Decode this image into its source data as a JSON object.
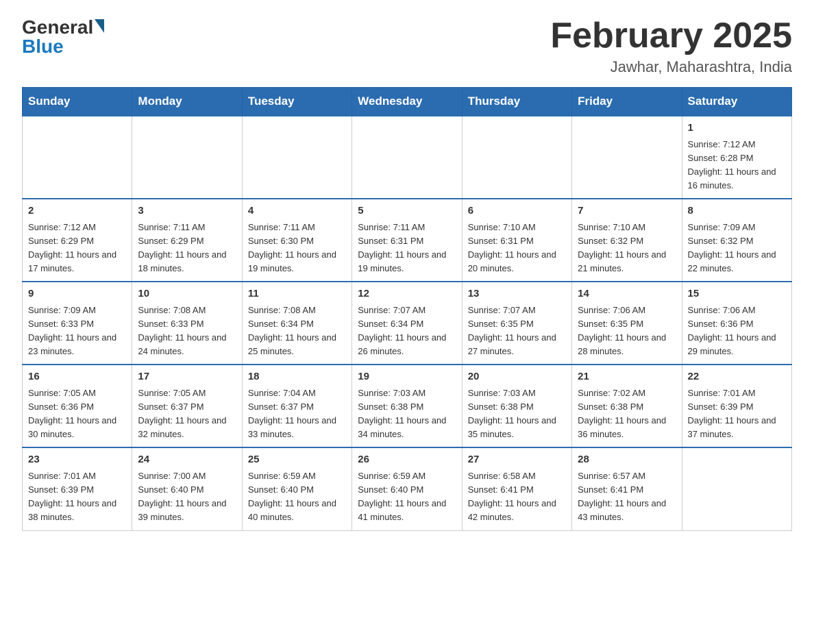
{
  "header": {
    "logo_general": "General",
    "logo_blue": "Blue",
    "month_title": "February 2025",
    "location": "Jawhar, Maharashtra, India"
  },
  "days_of_week": [
    "Sunday",
    "Monday",
    "Tuesday",
    "Wednesday",
    "Thursday",
    "Friday",
    "Saturday"
  ],
  "weeks": [
    [
      {
        "day": "",
        "info": ""
      },
      {
        "day": "",
        "info": ""
      },
      {
        "day": "",
        "info": ""
      },
      {
        "day": "",
        "info": ""
      },
      {
        "day": "",
        "info": ""
      },
      {
        "day": "",
        "info": ""
      },
      {
        "day": "1",
        "info": "Sunrise: 7:12 AM\nSunset: 6:28 PM\nDaylight: 11 hours and 16 minutes."
      }
    ],
    [
      {
        "day": "2",
        "info": "Sunrise: 7:12 AM\nSunset: 6:29 PM\nDaylight: 11 hours and 17 minutes."
      },
      {
        "day": "3",
        "info": "Sunrise: 7:11 AM\nSunset: 6:29 PM\nDaylight: 11 hours and 18 minutes."
      },
      {
        "day": "4",
        "info": "Sunrise: 7:11 AM\nSunset: 6:30 PM\nDaylight: 11 hours and 19 minutes."
      },
      {
        "day": "5",
        "info": "Sunrise: 7:11 AM\nSunset: 6:31 PM\nDaylight: 11 hours and 19 minutes."
      },
      {
        "day": "6",
        "info": "Sunrise: 7:10 AM\nSunset: 6:31 PM\nDaylight: 11 hours and 20 minutes."
      },
      {
        "day": "7",
        "info": "Sunrise: 7:10 AM\nSunset: 6:32 PM\nDaylight: 11 hours and 21 minutes."
      },
      {
        "day": "8",
        "info": "Sunrise: 7:09 AM\nSunset: 6:32 PM\nDaylight: 11 hours and 22 minutes."
      }
    ],
    [
      {
        "day": "9",
        "info": "Sunrise: 7:09 AM\nSunset: 6:33 PM\nDaylight: 11 hours and 23 minutes."
      },
      {
        "day": "10",
        "info": "Sunrise: 7:08 AM\nSunset: 6:33 PM\nDaylight: 11 hours and 24 minutes."
      },
      {
        "day": "11",
        "info": "Sunrise: 7:08 AM\nSunset: 6:34 PM\nDaylight: 11 hours and 25 minutes."
      },
      {
        "day": "12",
        "info": "Sunrise: 7:07 AM\nSunset: 6:34 PM\nDaylight: 11 hours and 26 minutes."
      },
      {
        "day": "13",
        "info": "Sunrise: 7:07 AM\nSunset: 6:35 PM\nDaylight: 11 hours and 27 minutes."
      },
      {
        "day": "14",
        "info": "Sunrise: 7:06 AM\nSunset: 6:35 PM\nDaylight: 11 hours and 28 minutes."
      },
      {
        "day": "15",
        "info": "Sunrise: 7:06 AM\nSunset: 6:36 PM\nDaylight: 11 hours and 29 minutes."
      }
    ],
    [
      {
        "day": "16",
        "info": "Sunrise: 7:05 AM\nSunset: 6:36 PM\nDaylight: 11 hours and 30 minutes."
      },
      {
        "day": "17",
        "info": "Sunrise: 7:05 AM\nSunset: 6:37 PM\nDaylight: 11 hours and 32 minutes."
      },
      {
        "day": "18",
        "info": "Sunrise: 7:04 AM\nSunset: 6:37 PM\nDaylight: 11 hours and 33 minutes."
      },
      {
        "day": "19",
        "info": "Sunrise: 7:03 AM\nSunset: 6:38 PM\nDaylight: 11 hours and 34 minutes."
      },
      {
        "day": "20",
        "info": "Sunrise: 7:03 AM\nSunset: 6:38 PM\nDaylight: 11 hours and 35 minutes."
      },
      {
        "day": "21",
        "info": "Sunrise: 7:02 AM\nSunset: 6:38 PM\nDaylight: 11 hours and 36 minutes."
      },
      {
        "day": "22",
        "info": "Sunrise: 7:01 AM\nSunset: 6:39 PM\nDaylight: 11 hours and 37 minutes."
      }
    ],
    [
      {
        "day": "23",
        "info": "Sunrise: 7:01 AM\nSunset: 6:39 PM\nDaylight: 11 hours and 38 minutes."
      },
      {
        "day": "24",
        "info": "Sunrise: 7:00 AM\nSunset: 6:40 PM\nDaylight: 11 hours and 39 minutes."
      },
      {
        "day": "25",
        "info": "Sunrise: 6:59 AM\nSunset: 6:40 PM\nDaylight: 11 hours and 40 minutes."
      },
      {
        "day": "26",
        "info": "Sunrise: 6:59 AM\nSunset: 6:40 PM\nDaylight: 11 hours and 41 minutes."
      },
      {
        "day": "27",
        "info": "Sunrise: 6:58 AM\nSunset: 6:41 PM\nDaylight: 11 hours and 42 minutes."
      },
      {
        "day": "28",
        "info": "Sunrise: 6:57 AM\nSunset: 6:41 PM\nDaylight: 11 hours and 43 minutes."
      },
      {
        "day": "",
        "info": ""
      }
    ]
  ]
}
